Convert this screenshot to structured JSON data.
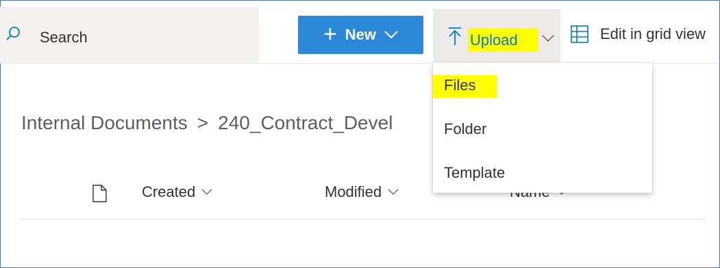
{
  "search": {
    "label": "Search",
    "icon": "search-icon"
  },
  "toolbar": {
    "new_label": "New",
    "upload_label": "Upload",
    "grid_view_label": "Edit in grid view"
  },
  "highlight_color": "#ffff00",
  "accent_color": "#2b88d8",
  "breadcrumb": {
    "root": "Internal Documents",
    "separator": ">",
    "current": "240_Contract_Devel"
  },
  "columns": {
    "created": "Created",
    "modified": "Modified",
    "name": "Name"
  },
  "upload_menu": {
    "items": [
      {
        "label": "Files",
        "highlighted": true
      },
      {
        "label": "Folder",
        "highlighted": false
      },
      {
        "label": "Template",
        "highlighted": false
      }
    ]
  }
}
